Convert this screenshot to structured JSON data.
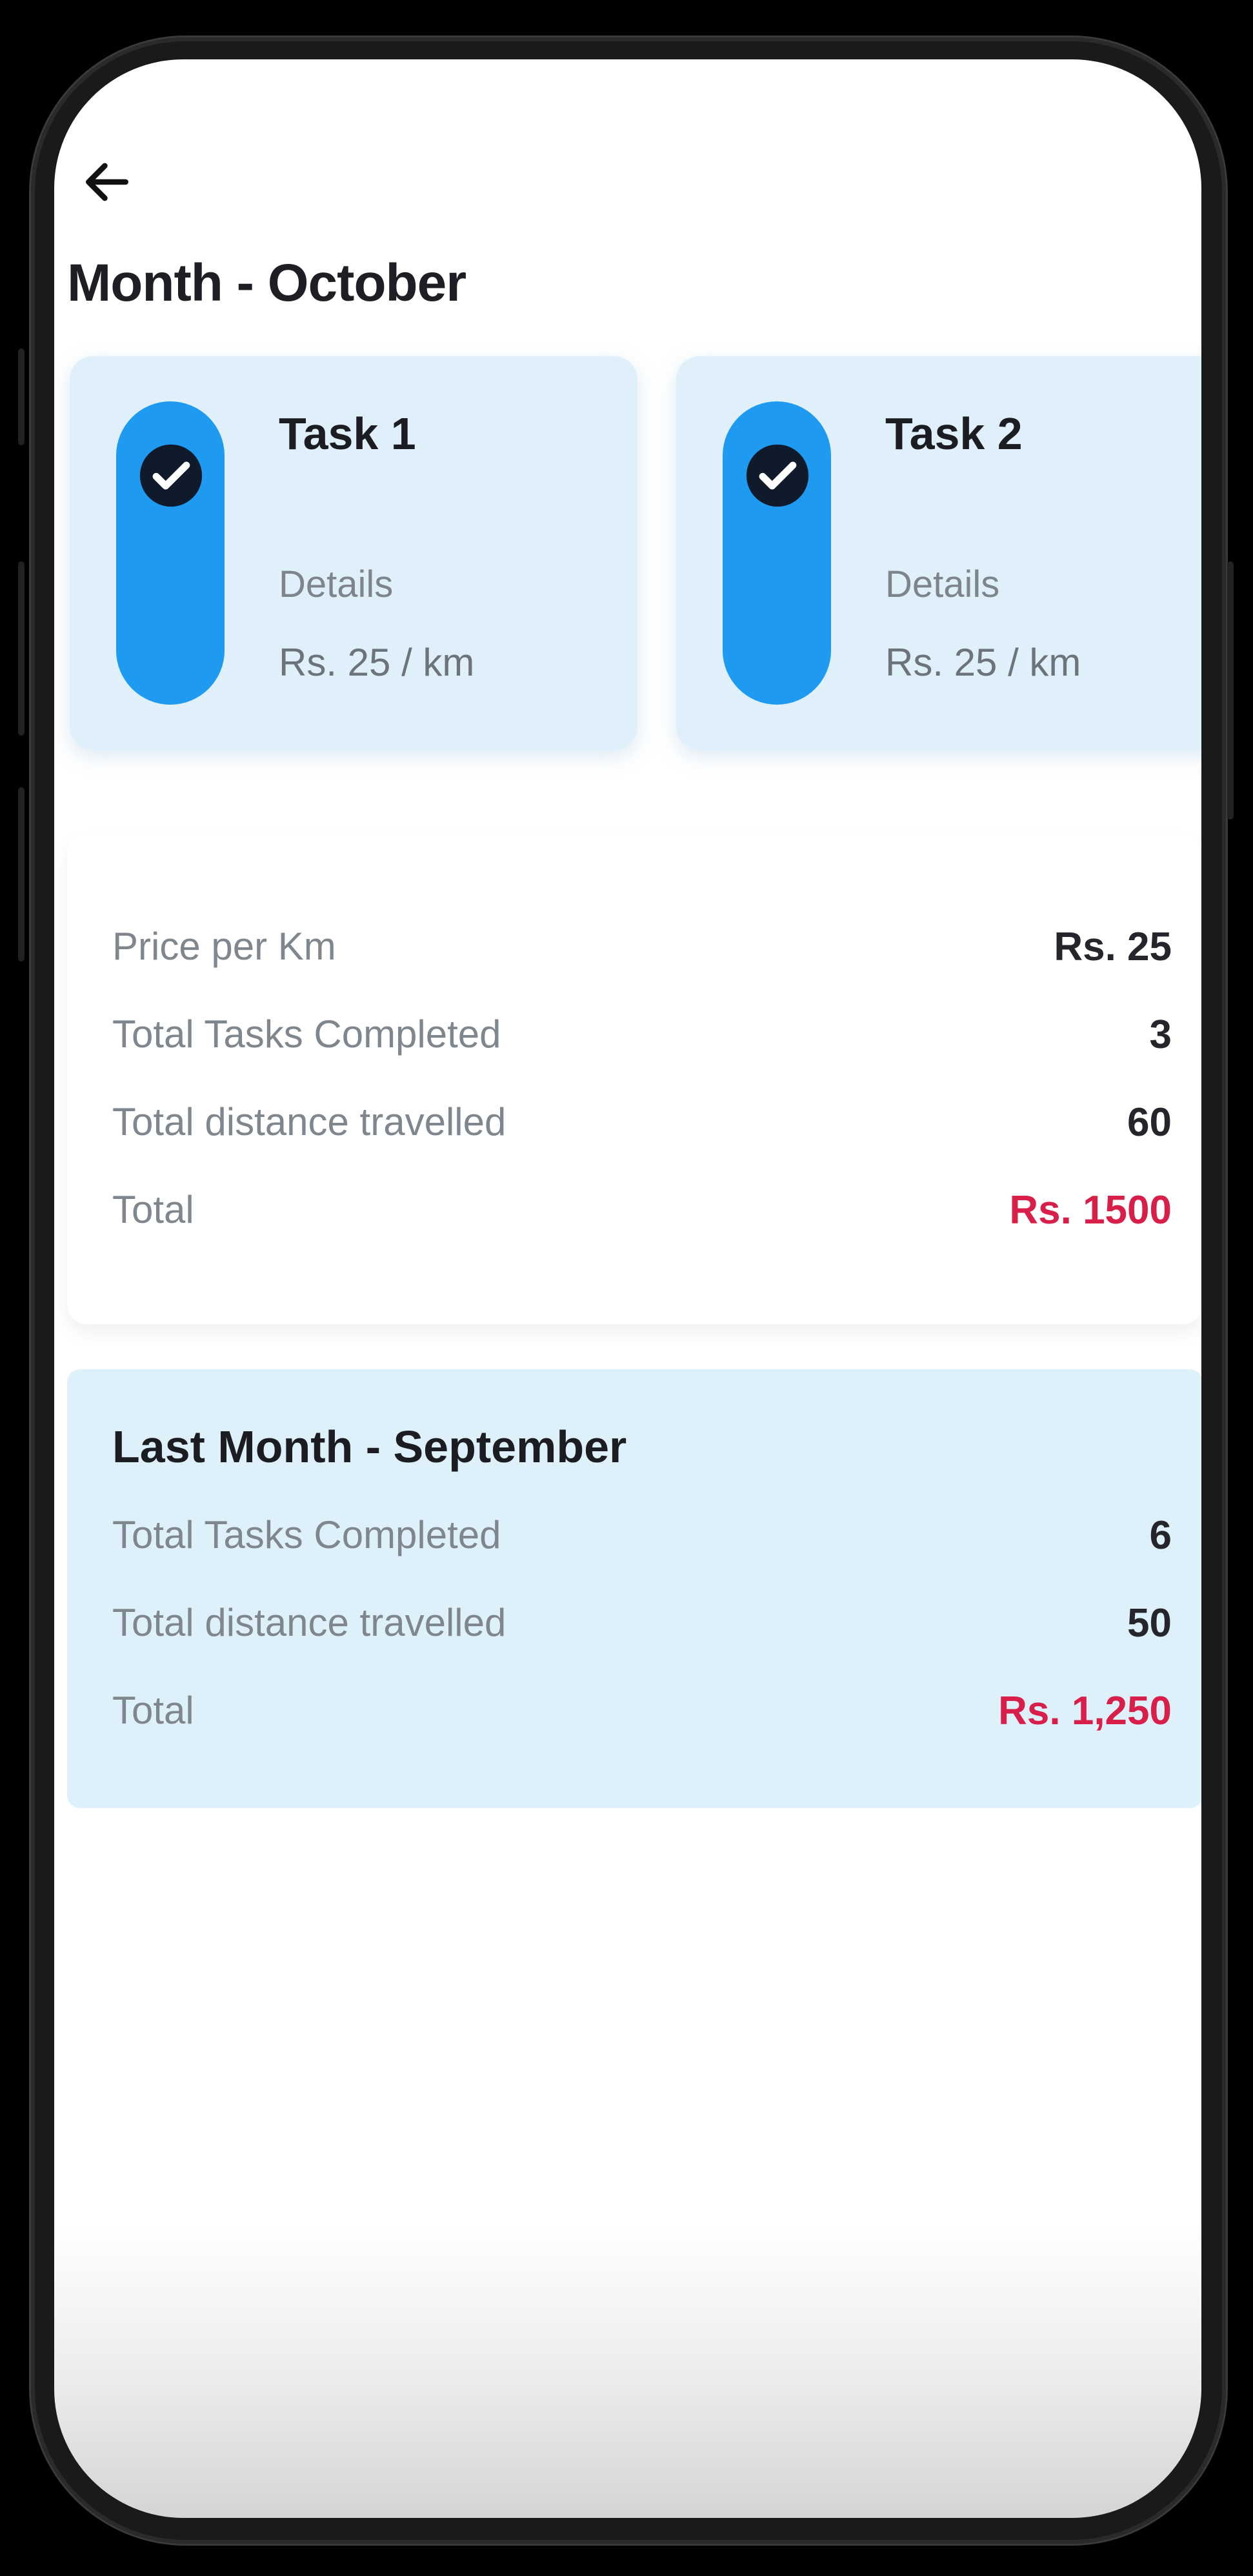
{
  "header": {
    "title": "Month - October"
  },
  "tasks": [
    {
      "title": "Task 1",
      "details_label": "Details",
      "rate": "Rs. 25 / km"
    },
    {
      "title": "Task 2",
      "details_label": "Details",
      "rate": "Rs. 25 / km"
    }
  ],
  "current_month": {
    "rows": [
      {
        "label": "Price per Km",
        "value": "Rs. 25"
      },
      {
        "label": "Total Tasks Completed",
        "value": "3"
      },
      {
        "label": "Total distance travelled",
        "value": "60"
      },
      {
        "label": "Total",
        "value": "Rs. 1500"
      }
    ]
  },
  "last_month": {
    "title": "Last Month - September",
    "rows": [
      {
        "label": "Total Tasks Completed",
        "value": "6"
      },
      {
        "label": "Total distance travelled",
        "value": "50"
      },
      {
        "label": "Total",
        "value": "Rs. 1,250"
      }
    ]
  },
  "colors": {
    "accent": "#1e9bf0",
    "card_background": "#dff0fb",
    "total_value": "#d81f4a"
  },
  "icons": {
    "back": "arrow-left-icon",
    "task_status": "check-circle-icon"
  }
}
